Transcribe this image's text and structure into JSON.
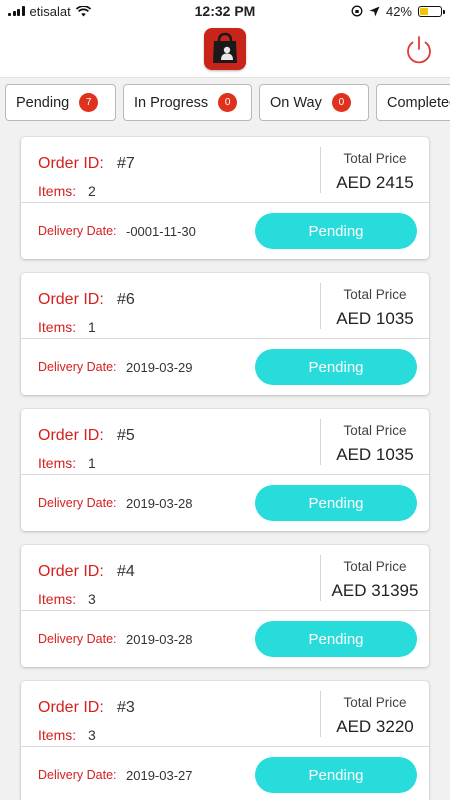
{
  "status_bar": {
    "carrier": "etisalat",
    "time": "12:32 PM",
    "battery": "42%"
  },
  "header": {
    "logo_icon": "shopping-bag-icon",
    "power_icon": "power-icon",
    "accent_color": "#c8241c"
  },
  "tabs": [
    {
      "label": "Pending",
      "count": "7"
    },
    {
      "label": "In Progress",
      "count": "0"
    },
    {
      "label": "On Way",
      "count": "0"
    },
    {
      "label": "Completed",
      "count": ""
    }
  ],
  "labels": {
    "order_id": "Order ID:",
    "items": "Items:",
    "total_price": "Total Price",
    "delivery_date": "Delivery Date:"
  },
  "orders": [
    {
      "id": "#7",
      "items": "2",
      "total": "AED 2415",
      "delivery_date": "-0001-11-30",
      "status": "Pending"
    },
    {
      "id": "#6",
      "items": "1",
      "total": "AED 1035",
      "delivery_date": "2019-03-29",
      "status": "Pending"
    },
    {
      "id": "#5",
      "items": "1",
      "total": "AED 1035",
      "delivery_date": "2019-03-28",
      "status": "Pending"
    },
    {
      "id": "#4",
      "items": "3",
      "total": "AED 31395",
      "delivery_date": "2019-03-28",
      "status": "Pending"
    },
    {
      "id": "#3",
      "items": "3",
      "total": "AED 3220",
      "delivery_date": "2019-03-27",
      "status": "Pending"
    }
  ],
  "colors": {
    "label_red": "#d4201f",
    "status_cyan": "#29dcdc",
    "badge_red": "#e0301e"
  }
}
